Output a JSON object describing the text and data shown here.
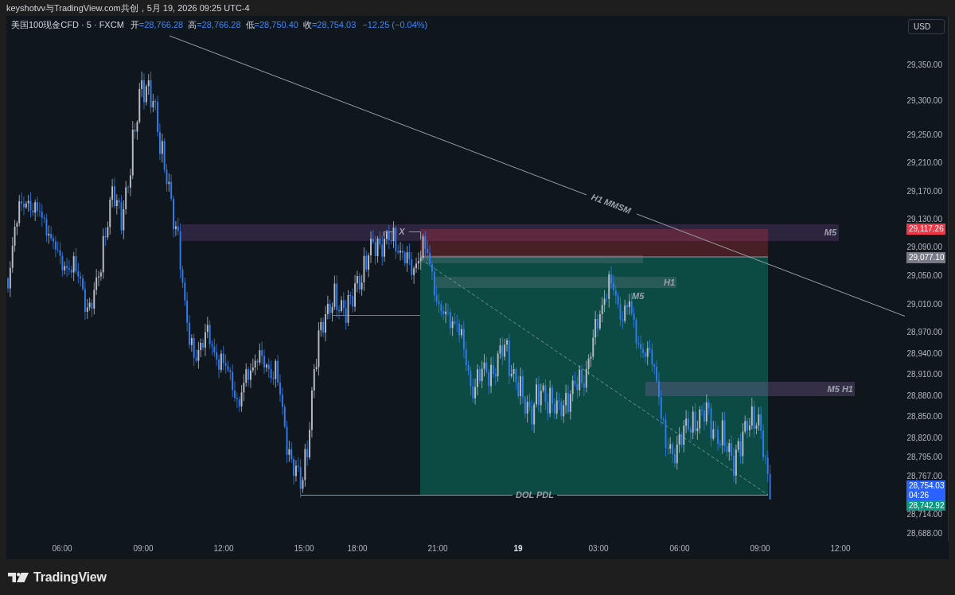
{
  "header": {
    "caption": "keyshotvv与TradingView.com共创，5月 19, 2026 09:25 UTC-4"
  },
  "legend": {
    "symbol": "美国100现金CFD · 5 · FXCM",
    "ohlc": [
      {
        "label": "开",
        "value": "=28,766.28"
      },
      {
        "label": "高",
        "value": "=28,766.28"
      },
      {
        "label": "低",
        "value": "=28,750.40"
      },
      {
        "label": "收",
        "value": "=28,754.03"
      }
    ],
    "change": "−12.25 (−0.04%)"
  },
  "currency_button": "USD",
  "price_axis": {
    "labels": [
      "29,350.00",
      "29,300.00",
      "29,250.00",
      "29,210.00",
      "29,170.00",
      "29,130.00",
      "29,090.00",
      "29,050.00",
      "29,010.00",
      "28,970.00",
      "28,940.00",
      "28,910.00",
      "28,880.00",
      "28,850.00",
      "28,820.00",
      "28,795.00",
      "28,767.00",
      "28,714.00",
      "28,688.00"
    ],
    "badges": [
      {
        "price": "29,117.26",
        "color": "#f23645"
      },
      {
        "price": "29,077.10",
        "color": "#787b86"
      },
      {
        "price": "28,754.03",
        "countdown": "04:26",
        "color": "#2962ff"
      },
      {
        "price": "28,742.92",
        "color": "#089981"
      }
    ]
  },
  "time_axis": [
    {
      "label": "06:00",
      "kind": "time"
    },
    {
      "label": "09:00",
      "kind": "time"
    },
    {
      "label": "12:00",
      "kind": "time"
    },
    {
      "label": "15:00",
      "kind": "time"
    },
    {
      "label": "18:00",
      "kind": "time"
    },
    {
      "label": "21:00",
      "kind": "time"
    },
    {
      "label": "19",
      "kind": "day"
    },
    {
      "label": "03:00",
      "kind": "time"
    },
    {
      "label": "06:00",
      "kind": "time"
    },
    {
      "label": "09:00",
      "kind": "time"
    },
    {
      "label": "12:00",
      "kind": "time"
    }
  ],
  "annotations": [
    "H1 MMSM",
    "X",
    "M5",
    "H1",
    "M5",
    "M5 H1",
    "DOL PDL"
  ],
  "footer": {
    "logo_text": "TradingView"
  }
}
